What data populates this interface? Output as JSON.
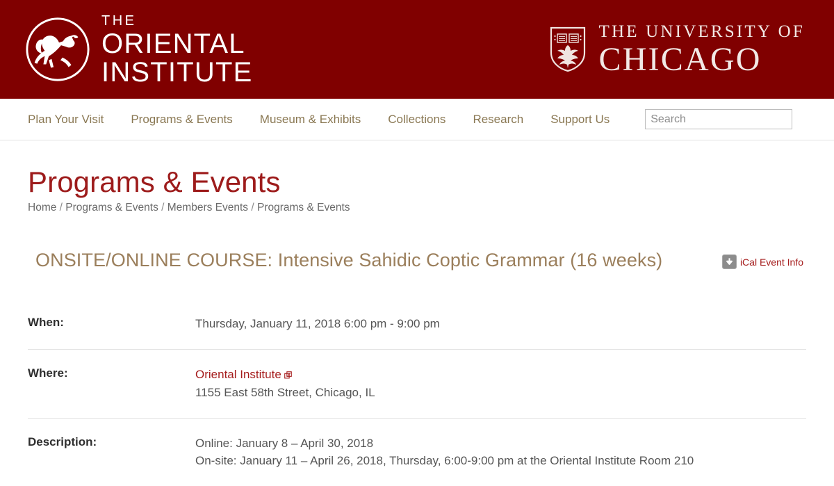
{
  "header": {
    "background_color": "#800000",
    "oi_logo": {
      "icon": "oriental-institute-winged-lion-mark",
      "line1": "THE",
      "line2": "ORIENTAL",
      "line3": "INSTITUTE"
    },
    "uchicago_logo": {
      "icon": "uchicago-shield-phoenix-mark",
      "line1": "THE UNIVERSITY OF",
      "line2": "CHICAGO"
    }
  },
  "nav": {
    "items": [
      {
        "label": "Plan Your Visit"
      },
      {
        "label": "Programs & Events"
      },
      {
        "label": "Museum & Exhibits"
      },
      {
        "label": "Collections"
      },
      {
        "label": "Research"
      },
      {
        "label": "Support Us"
      }
    ],
    "search": {
      "value": "",
      "placeholder": "Search"
    }
  },
  "page": {
    "title": "Programs & Events",
    "title_color": "#9d1b1b",
    "breadcrumb": {
      "items": [
        "Home",
        "Programs & Events",
        "Members Events",
        "Programs & Events"
      ],
      "separator": "/"
    }
  },
  "event": {
    "title": "ONSITE/ONLINE COURSE: Intensive Sahidic Coptic Grammar (16 weeks)",
    "title_color": "#9b7f5c",
    "ical": {
      "icon": "download-arrow-icon",
      "label": "iCal Event Info",
      "label_color": "#a51c1c"
    },
    "details": [
      {
        "label": "When:",
        "lines": [
          "Thursday, January 11, 2018 6:00 pm - 9:00 pm"
        ]
      },
      {
        "label": "Where:",
        "link": "Oriental Institute",
        "link_icon": "external-link-icon",
        "lines": [
          "1155 East 58th Street, Chicago, IL"
        ]
      },
      {
        "label": "Description:",
        "lines": [
          "Online: January 8 – April 30, 2018",
          "On-site: January 11 – April 26, 2018, Thursday, 6:00-9:00 pm at the Oriental Institute Room 210"
        ]
      }
    ]
  }
}
